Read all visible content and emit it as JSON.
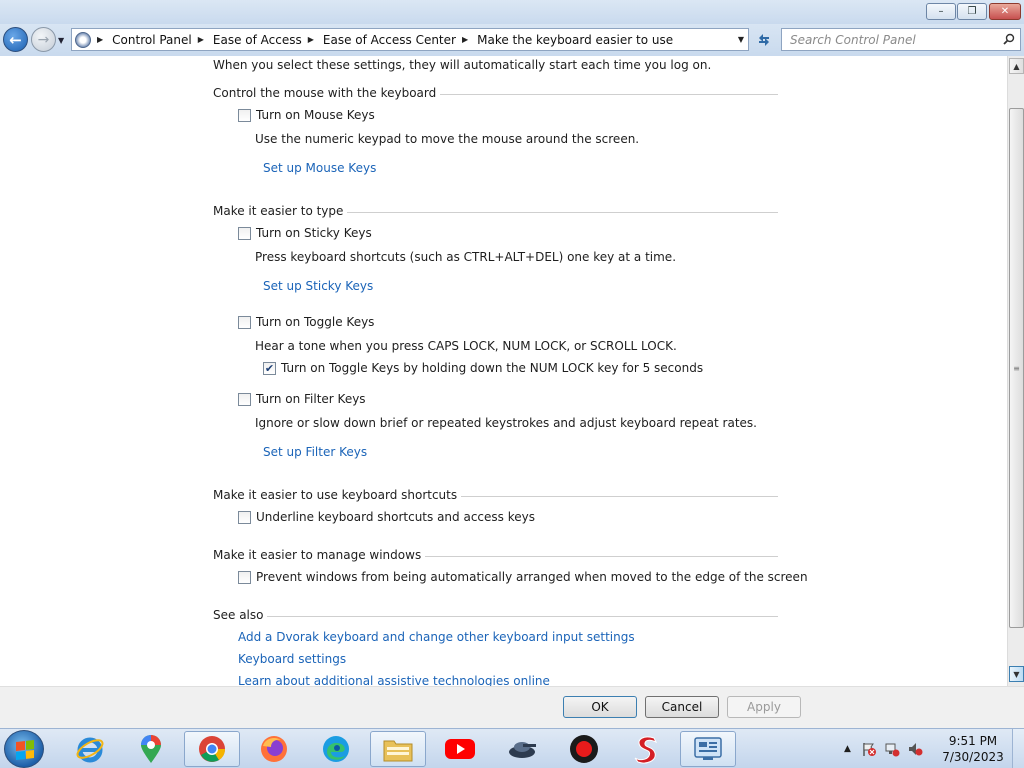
{
  "window": {
    "minimize_glyph": "–",
    "maximize_glyph": "❐",
    "close_glyph": "✕"
  },
  "address_bar": {
    "breadcrumbs": [
      "Control Panel",
      "Ease of Access",
      "Ease of Access Center",
      "Make the keyboard easier to use"
    ],
    "search_placeholder": "Search Control Panel"
  },
  "page": {
    "intro": "When you select these settings, they will automatically start each time you log on.",
    "sections": {
      "mouse": {
        "title": "Control the mouse with the keyboard",
        "checkbox_label": "Turn on Mouse Keys",
        "checked": false,
        "description": "Use the numeric keypad to move the mouse around the screen.",
        "link": "Set up Mouse Keys"
      },
      "type": {
        "title": "Make it easier to type",
        "sticky": {
          "checkbox_label": "Turn on Sticky Keys",
          "checked": false,
          "description": "Press keyboard shortcuts (such as CTRL+ALT+DEL) one key at a time.",
          "link": "Set up Sticky Keys"
        },
        "toggle": {
          "checkbox_label": "Turn on Toggle Keys",
          "checked": false,
          "description": "Hear a tone when you press CAPS LOCK, NUM LOCK, or SCROLL LOCK.",
          "sub_checkbox_label": "Turn on Toggle Keys by holding down the NUM LOCK key for 5 seconds",
          "sub_checked": true
        },
        "filter": {
          "checkbox_label": "Turn on Filter Keys",
          "checked": false,
          "description": "Ignore or slow down brief or repeated keystrokes and adjust keyboard repeat rates.",
          "link": "Set up Filter Keys"
        }
      },
      "shortcuts": {
        "title": "Make it easier to use keyboard shortcuts",
        "checkbox_label": "Underline keyboard shortcuts and access keys",
        "checked": false
      },
      "windows": {
        "title": "Make it easier to manage windows",
        "checkbox_label": "Prevent windows from being automatically arranged when moved to the edge of the screen",
        "checked": false
      },
      "see_also": {
        "title": "See also",
        "links": [
          "Add a Dvorak keyboard and change other keyboard input settings",
          "Keyboard settings",
          "Learn about additional assistive technologies online"
        ]
      }
    }
  },
  "footer": {
    "ok": "OK",
    "cancel": "Cancel",
    "apply": "Apply"
  },
  "taskbar": {
    "apps": [
      "internet-explorer",
      "google-maps",
      "chrome",
      "firefox",
      "edge",
      "file-explorer",
      "youtube",
      "game-app",
      "screen-recorder",
      "s-app",
      "control-panel"
    ],
    "clock_time": "9:51 PM",
    "clock_date": "7/30/2023"
  },
  "colors": {
    "link": "#1b64b8",
    "taskbar": "#c3d5ec"
  }
}
